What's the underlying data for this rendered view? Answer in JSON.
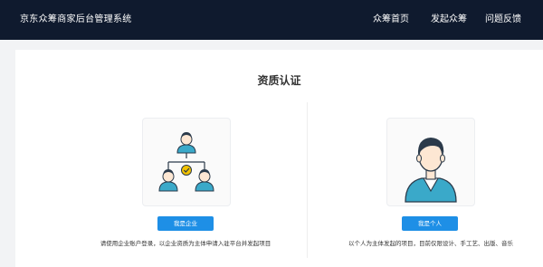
{
  "header": {
    "app_title": "京东众筹商家后台管理系统",
    "nav": [
      "众筹首页",
      "发起众筹",
      "问题反馈"
    ]
  },
  "main": {
    "title": "资质认证",
    "enterprise": {
      "button": "我是企业",
      "description": "请使用企业账户登录，以企业资质为主体申请入驻平台并发起项目"
    },
    "individual": {
      "button": "我是个人",
      "description": "以个人为主体发起的项目，目前仅限设计、手工艺、出版、音乐"
    }
  },
  "colors": {
    "header_bg": "#0f1a2e",
    "accent": "#1e8fe6",
    "icon_yellow": "#f2c200"
  },
  "icons": [
    "org-chart-icon",
    "person-avatar-icon",
    "check-icon"
  ]
}
